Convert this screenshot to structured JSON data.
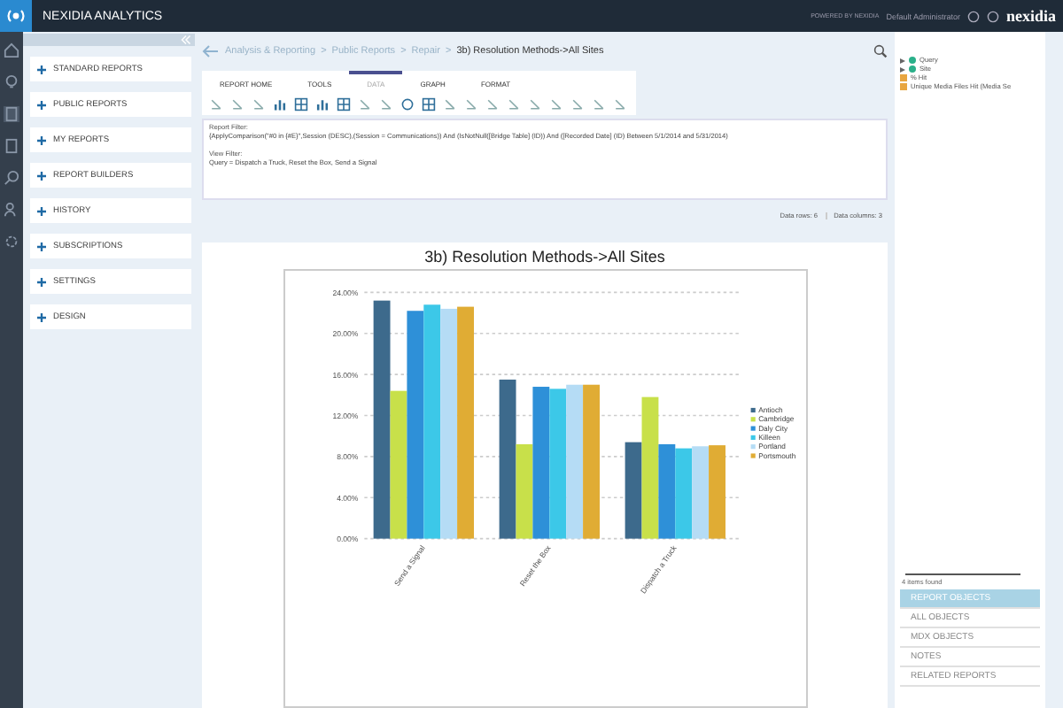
{
  "app": {
    "title": "NEXIDIA ANALYTICS",
    "powered": "POWERED BY NEXIDIA",
    "user": "Default Administrator",
    "brand": "nexidia"
  },
  "sidebar": {
    "items": [
      {
        "label": "STANDARD REPORTS"
      },
      {
        "label": "PUBLIC REPORTS"
      },
      {
        "label": "MY REPORTS"
      },
      {
        "label": "REPORT BUILDERS"
      },
      {
        "label": "HISTORY"
      },
      {
        "label": "SUBSCRIPTIONS"
      },
      {
        "label": "SETTINGS"
      },
      {
        "label": "DESIGN"
      }
    ]
  },
  "breadcrumb": {
    "items": [
      {
        "label": "Analysis & Reporting",
        "current": false
      },
      {
        "label": "Public Reports",
        "current": false
      },
      {
        "label": "Repair",
        "current": false
      },
      {
        "label": "3b) Resolution Methods->All Sites",
        "current": true
      }
    ],
    "separators": [
      ">",
      ">",
      ">"
    ]
  },
  "tabs": [
    {
      "label": "REPORT HOME",
      "selected": false
    },
    {
      "label": "TOOLS",
      "selected": false
    },
    {
      "label": "DATA",
      "selected": true
    },
    {
      "label": "GRAPH",
      "selected": false
    },
    {
      "label": "FORMAT",
      "selected": false
    }
  ],
  "filters": [
    {
      "label": "Report Filter:",
      "text": "{ApplyComparison(\"#0 in {#E}\",Session (DESC),(Session = Communications)) And (IsNotNull([Bridge Table] (ID)) And ([Recorded Date] (ID) Between 5/1/2014 and 5/31/2014)"
    },
    {
      "label": "View Filter:",
      "text": "Query = Dispatch a Truck, Reset the Box, Send a Signal"
    }
  ],
  "stats": [
    "Data rows: 6",
    "Data columns: 3"
  ],
  "chart_data": {
    "type": "bar",
    "title": "3b) Resolution Methods->All Sites",
    "categories": [
      "Send a Signal",
      "Reset the Box",
      "Dispatch a Truck"
    ],
    "yticks": [
      {
        "value": 0,
        "label": "0.00%"
      },
      {
        "value": 4,
        "label": "4.00%"
      },
      {
        "value": 8,
        "label": "8.00%"
      },
      {
        "value": 12,
        "label": "12.00%"
      },
      {
        "value": 16,
        "label": "16.00%"
      },
      {
        "value": 20,
        "label": "20.00%"
      },
      {
        "value": 24,
        "label": "24.00%"
      }
    ],
    "ylim": [
      0,
      24
    ],
    "grid": true,
    "legend": "right",
    "series": [
      {
        "name": "Antioch",
        "color": "#3d6a8c",
        "values": [
          23.2,
          15.5,
          9.4
        ]
      },
      {
        "name": "Cambridge",
        "color": "#c8e04a",
        "values": [
          14.4,
          9.2,
          13.8
        ]
      },
      {
        "name": "Daly City",
        "color": "#2e90d8",
        "values": [
          22.2,
          14.8,
          9.2
        ]
      },
      {
        "name": "Killeen",
        "color": "#3cc8e8",
        "values": [
          22.8,
          14.6,
          8.8
        ]
      },
      {
        "name": "Portland",
        "color": "#b5dcf5",
        "values": [
          22.4,
          15.0,
          9.0
        ]
      },
      {
        "name": "Portsmouth",
        "color": "#e0ac34",
        "values": [
          22.6,
          15.0,
          9.1
        ]
      }
    ]
  },
  "objects": {
    "tree": [
      {
        "label": "Query",
        "kind": "dimension"
      },
      {
        "label": "Site",
        "kind": "dimension"
      },
      {
        "label": "% Hit",
        "kind": "measure"
      },
      {
        "label": "Unique Media Files Hit (Media Se",
        "kind": "measure"
      }
    ],
    "count": "4 items found",
    "tabs": [
      {
        "label": "REPORT OBJECTS",
        "selected": true
      },
      {
        "label": "ALL OBJECTS",
        "selected": false
      },
      {
        "label": "MDX OBJECTS",
        "selected": false
      },
      {
        "label": "NOTES",
        "selected": false
      },
      {
        "label": "RELATED REPORTS",
        "selected": false
      }
    ]
  }
}
